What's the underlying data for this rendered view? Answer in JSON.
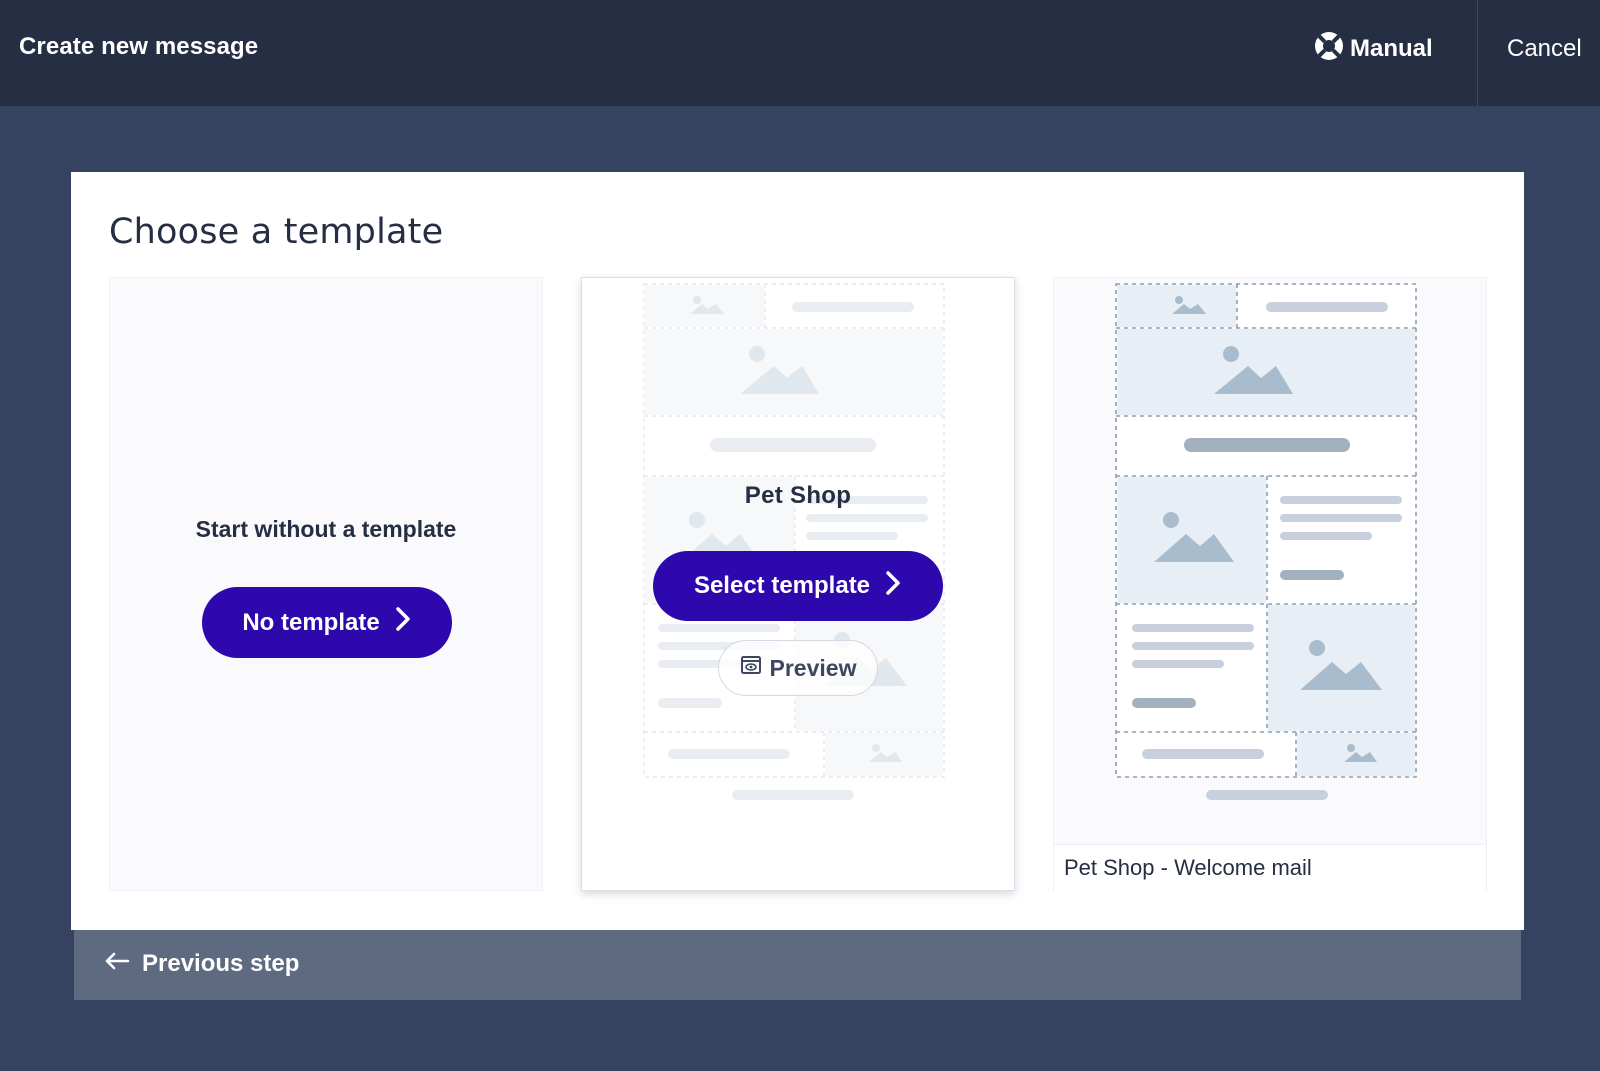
{
  "header": {
    "title": "Create new message",
    "manual_label": "Manual",
    "cancel_label": "Cancel"
  },
  "panel": {
    "title": "Choose a template"
  },
  "cards": {
    "blank": {
      "heading": "Start without a template",
      "button_label": "No template"
    },
    "pet_shop": {
      "title": "Pet Shop",
      "select_label": "Select template",
      "preview_label": "Preview"
    },
    "welcome": {
      "caption": "Pet Shop - Welcome mail"
    }
  },
  "footer": {
    "previous_label": "Previous step"
  },
  "icons": {
    "manual": "lifebuoy-icon",
    "chevron": "chevron-right-icon",
    "preview": "eye-icon",
    "back": "arrow-left-icon"
  },
  "colors": {
    "topbar": "#252e42",
    "background": "#354360",
    "primary_button": "#2c08ad",
    "footer": "#5e6a80"
  }
}
